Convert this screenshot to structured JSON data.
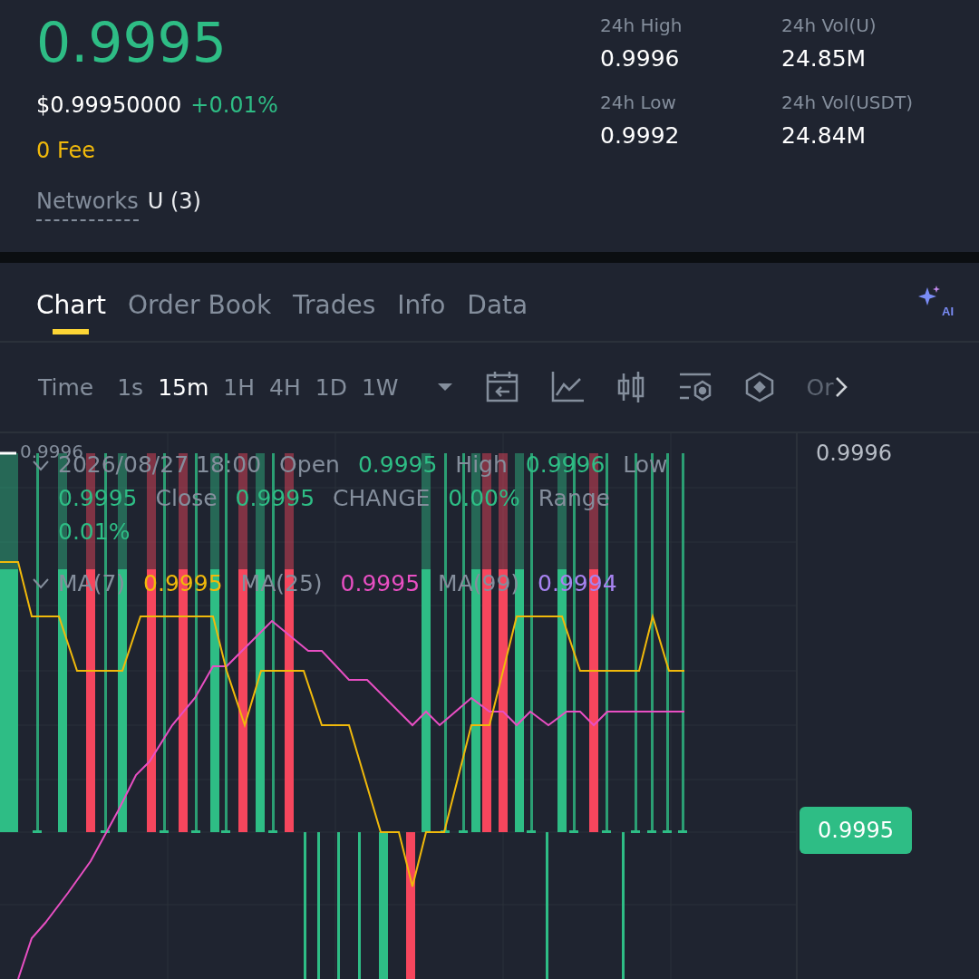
{
  "ticker": {
    "price": "0.9995",
    "usd_price": "$0.99950000",
    "change": "+0.01%",
    "fee": "0 Fee",
    "networks_label": "Networks",
    "networks_value": "U (3)"
  },
  "stats": [
    {
      "label": "24h High",
      "value": "0.9996"
    },
    {
      "label": "24h Vol(U)",
      "value": "24.85M"
    },
    {
      "label": "24h Low",
      "value": "0.9992"
    },
    {
      "label": "24h Vol(USDT)",
      "value": "24.84M"
    }
  ],
  "tabs": [
    {
      "label": "Chart",
      "selected": true
    },
    {
      "label": "Order Book",
      "selected": false
    },
    {
      "label": "Trades",
      "selected": false
    },
    {
      "label": "Info",
      "selected": false
    },
    {
      "label": "Data",
      "selected": false
    }
  ],
  "ai_button": {
    "label": "AI"
  },
  "toolbar": {
    "time_label": "Time",
    "intervals": [
      {
        "label": "1s",
        "selected": false
      },
      {
        "label": "15m",
        "selected": true
      },
      {
        "label": "1H",
        "selected": false
      },
      {
        "label": "4H",
        "selected": false
      },
      {
        "label": "1D",
        "selected": false
      },
      {
        "label": "1W",
        "selected": false
      }
    ],
    "more_label": "Or"
  },
  "chart": {
    "max_label": "0.9996",
    "axis_label": "0.9996",
    "price_tag": "0.9995",
    "ohlc": [
      {
        "text": "2026/08/27 18:00",
        "kind": "label"
      },
      {
        "text": "Open",
        "kind": "label"
      },
      {
        "text": "0.9995",
        "kind": "value"
      },
      {
        "text": "High",
        "kind": "label"
      },
      {
        "text": "0.9996",
        "kind": "value"
      },
      {
        "text": "Low",
        "kind": "label"
      },
      {
        "text": "0.9995",
        "kind": "value"
      },
      {
        "text": "Close",
        "kind": "label"
      },
      {
        "text": "0.9995",
        "kind": "value"
      },
      {
        "text": "CHANGE",
        "kind": "label"
      },
      {
        "text": "0.00%",
        "kind": "value"
      },
      {
        "text": "Range",
        "kind": "label"
      },
      {
        "text": "0.01%",
        "kind": "value"
      }
    ],
    "ma": [
      {
        "label": "MA(7)",
        "value": "0.9995",
        "color": "#f0b90b"
      },
      {
        "label": "MA(25)",
        "value": "0.9995",
        "color": "#e84fc3"
      },
      {
        "label": "MA(99)",
        "value": "0.9994",
        "color": "#a783f0"
      }
    ]
  }
}
